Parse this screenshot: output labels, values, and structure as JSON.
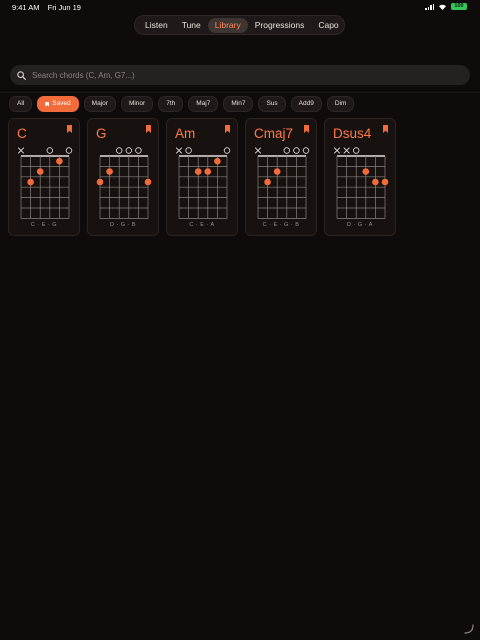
{
  "status": {
    "time": "9:41 AM",
    "date": "Fri Jun 19",
    "battery": "100"
  },
  "nav": {
    "tabs": [
      {
        "label": "Listen"
      },
      {
        "label": "Tune"
      },
      {
        "label": "Library",
        "active": true
      },
      {
        "label": "Progressions"
      },
      {
        "label": "Capo"
      }
    ]
  },
  "search": {
    "placeholder": "Search chords (C, Am, G7...)",
    "value": ""
  },
  "filters": [
    {
      "label": "All"
    },
    {
      "label": "Saved",
      "active": true,
      "icon": "bookmark-icon"
    },
    {
      "label": "Major"
    },
    {
      "label": "Minor"
    },
    {
      "label": "7th"
    },
    {
      "label": "Maj7"
    },
    {
      "label": "Min7"
    },
    {
      "label": "Sus"
    },
    {
      "label": "Add9"
    },
    {
      "label": "Dim"
    }
  ],
  "colors": {
    "accent": "#f26b3a",
    "background": "#0f0b0a",
    "card": "#171210"
  },
  "chords": [
    {
      "name": "C",
      "notes": "C · E · G",
      "strings": [
        "x",
        "",
        "",
        "o",
        "",
        "o"
      ],
      "dots": [
        {
          "string": 2,
          "fret": 3
        },
        {
          "string": 3,
          "fret": 2
        },
        {
          "string": 5,
          "fret": 1
        }
      ]
    },
    {
      "name": "G",
      "notes": "D · G · B",
      "strings": [
        "",
        "",
        "o",
        "o",
        "o",
        ""
      ],
      "dots": [
        {
          "string": 1,
          "fret": 3
        },
        {
          "string": 2,
          "fret": 2
        },
        {
          "string": 6,
          "fret": 3
        }
      ]
    },
    {
      "name": "Am",
      "notes": "C · E · A",
      "strings": [
        "x",
        "o",
        "",
        "",
        "",
        "o"
      ],
      "dots": [
        {
          "string": 3,
          "fret": 2
        },
        {
          "string": 4,
          "fret": 2
        },
        {
          "string": 5,
          "fret": 1
        }
      ]
    },
    {
      "name": "Cmaj7",
      "notes": "C · E · G · B",
      "strings": [
        "x",
        "",
        "",
        "o",
        "o",
        "o"
      ],
      "dots": [
        {
          "string": 2,
          "fret": 3
        },
        {
          "string": 3,
          "fret": 2
        }
      ]
    },
    {
      "name": "Dsus4",
      "notes": "D · G · A",
      "strings": [
        "x",
        "x",
        "o",
        "",
        "",
        ""
      ],
      "dots": [
        {
          "string": 4,
          "fret": 2
        },
        {
          "string": 5,
          "fret": 3
        },
        {
          "string": 6,
          "fret": 3
        }
      ]
    }
  ]
}
